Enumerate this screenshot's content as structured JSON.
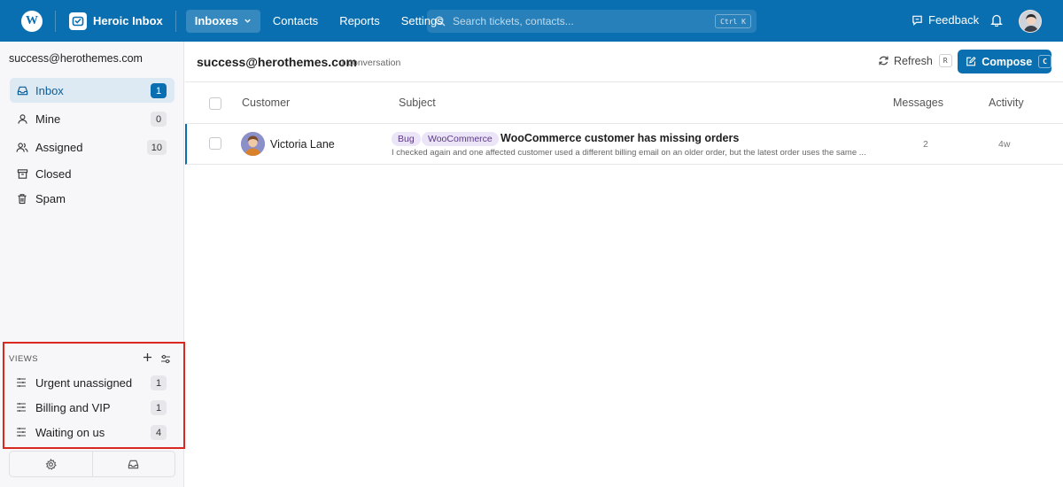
{
  "topbar": {
    "brand": "Heroic Inbox",
    "nav": [
      {
        "label": "Inboxes"
      },
      {
        "label": "Contacts"
      },
      {
        "label": "Reports"
      },
      {
        "label": "Settings"
      }
    ],
    "search_placeholder": "Search tickets, contacts...",
    "search_shortcut": "Ctrl K",
    "feedback_label": "Feedback",
    "accent": "#0a6fb0"
  },
  "sidebar": {
    "email": "success@herothemes.com",
    "items": [
      {
        "label": "Inbox",
        "count": "1",
        "icon": "inbox-icon"
      },
      {
        "label": "Mine",
        "count": "0",
        "icon": "user-icon"
      },
      {
        "label": "Assigned",
        "count": "10",
        "icon": "users-icon"
      },
      {
        "label": "Closed",
        "icon": "archive-icon"
      },
      {
        "label": "Spam",
        "icon": "trash-icon"
      }
    ],
    "views_header": "VIEWS",
    "views": [
      {
        "label": "Urgent unassigned",
        "count": "1"
      },
      {
        "label": "Billing and VIP",
        "count": "1"
      },
      {
        "label": "Waiting on us",
        "count": "4"
      }
    ]
  },
  "main": {
    "title": "success@herothemes.com",
    "subtitle": "1 conversation",
    "refresh_label": "Refresh",
    "refresh_shortcut": "R",
    "compose_label": "Compose",
    "compose_shortcut": "C",
    "columns": {
      "customer": "Customer",
      "subject": "Subject",
      "messages": "Messages",
      "activity": "Activity"
    },
    "rows": [
      {
        "customer": "Victoria Lane",
        "tags": [
          "Bug",
          "WooCommerce"
        ],
        "subject": "WooCommerce customer has missing orders",
        "preview": "I checked again and one affected customer used a different billing email on an older order, but the latest order uses the same ...",
        "messages": "2",
        "activity": "4w"
      }
    ]
  }
}
